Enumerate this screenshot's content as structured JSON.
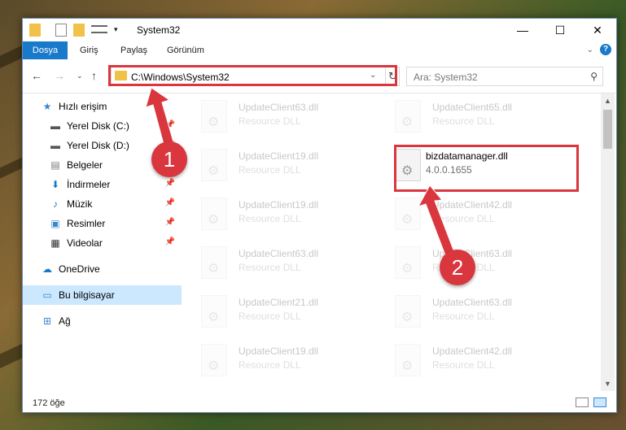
{
  "window": {
    "title": "System32"
  },
  "ribbon": {
    "tabs": [
      "Dosya",
      "Giriş",
      "Paylaş",
      "Görünüm"
    ]
  },
  "address": {
    "path": "C:\\Windows\\System32"
  },
  "search": {
    "placeholder": "Ara: System32"
  },
  "sidebar": {
    "items": [
      {
        "label": "Hızlı erişim",
        "icon": "star-icon",
        "pinned": false
      },
      {
        "label": "Yerel Disk (C:)",
        "icon": "drive-icon",
        "pinned": true
      },
      {
        "label": "Yerel Disk (D:)",
        "icon": "drive-icon",
        "pinned": true
      },
      {
        "label": "Belgeler",
        "icon": "documents-icon",
        "pinned": true
      },
      {
        "label": "İndirmeler",
        "icon": "download-icon",
        "pinned": true
      },
      {
        "label": "Müzik",
        "icon": "music-icon",
        "pinned": true
      },
      {
        "label": "Resimler",
        "icon": "pictures-icon",
        "pinned": true
      },
      {
        "label": "Videolar",
        "icon": "video-icon",
        "pinned": true
      },
      {
        "label": "OneDrive",
        "icon": "cloud-icon",
        "pinned": false
      },
      {
        "label": "Bu bilgisayar",
        "icon": "computer-icon",
        "pinned": false
      },
      {
        "label": "Ağ",
        "icon": "network-icon",
        "pinned": false
      }
    ]
  },
  "files": {
    "left": [
      {
        "name": "UpdateClient63.dll",
        "sub": "Resource DLL"
      },
      {
        "name": "UpdateClient19.dll",
        "sub": "Resource DLL"
      },
      {
        "name": "UpdateClient19.dll",
        "sub": "Resource DLL"
      },
      {
        "name": "UpdateClient63.dll",
        "sub": "Resource DLL"
      },
      {
        "name": "UpdateClient21.dll",
        "sub": "Resource DLL"
      },
      {
        "name": "UpdateClient19.dll",
        "sub": "Resource DLL"
      }
    ],
    "right": [
      {
        "name": "UpdateClient65.dll",
        "sub": "Resource DLL"
      },
      {
        "name": "bizdatamanager.dll",
        "sub": "4.0.0.1655"
      },
      {
        "name": "UpdateClient42.dll",
        "sub": "Resource DLL"
      },
      {
        "name": "UpdateClient63.dll",
        "sub": "Resource DLL"
      },
      {
        "name": "UpdateClient63.dll",
        "sub": "Resource DLL"
      },
      {
        "name": "UpdateClient42.dll",
        "sub": "Resource DLL"
      }
    ]
  },
  "status": {
    "count": "172 öğe"
  },
  "annotations": {
    "step1": "1",
    "step2": "2"
  },
  "colors": {
    "accent": "#1979ca",
    "highlight": "#d9363e",
    "selected": "#cce8ff"
  }
}
